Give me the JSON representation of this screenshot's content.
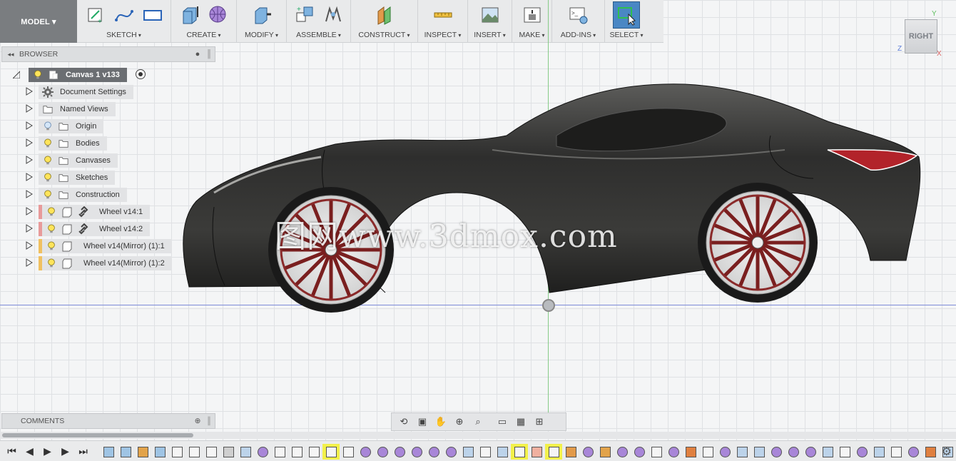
{
  "toolbar": {
    "model": "MODEL ▾",
    "groups": [
      {
        "label": "SKETCH"
      },
      {
        "label": "CREATE"
      },
      {
        "label": "MODIFY"
      },
      {
        "label": "ASSEMBLE"
      },
      {
        "label": "CONSTRUCT"
      },
      {
        "label": "INSPECT"
      },
      {
        "label": "INSERT"
      },
      {
        "label": "MAKE"
      },
      {
        "label": "ADD-INS"
      },
      {
        "label": "SELECT"
      }
    ]
  },
  "browser": {
    "title": "BROWSER",
    "root": "Canvas 1 v133",
    "items": [
      {
        "label": "Document Settings"
      },
      {
        "label": "Named Views"
      },
      {
        "label": "Origin"
      },
      {
        "label": "Bodies"
      },
      {
        "label": "Canvases"
      },
      {
        "label": "Sketches"
      },
      {
        "label": "Construction"
      },
      {
        "label": "Wheel v14:1"
      },
      {
        "label": "Wheel v14:2"
      },
      {
        "label": "Wheel v14(Mirror) (1):1"
      },
      {
        "label": "Wheel v14(Mirror) (1):2"
      }
    ]
  },
  "viewcube": {
    "face": "RIGHT",
    "axis_y": "Y",
    "axis_z": "Z",
    "axis_x": "X"
  },
  "watermark": "图网www.3dmox.com",
  "comments": {
    "title": "COMMENTS"
  },
  "colors": {
    "accent": "#4a87c4",
    "highlight": "#f2f04a",
    "car_body": "#2f2f2e",
    "rim_red": "#8a2a2a"
  },
  "icons": {
    "timeline_controls": [
      "skip-start-icon",
      "step-back-icon",
      "play-icon",
      "step-forward-icon",
      "skip-end-icon"
    ],
    "settings": "gear-icon"
  }
}
